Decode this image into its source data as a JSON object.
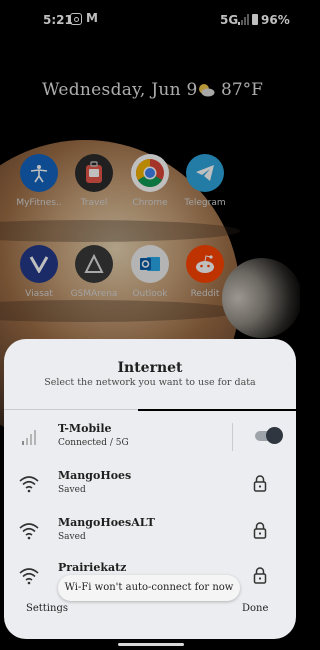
{
  "status_bar": {
    "time": "5:21",
    "network": "5G",
    "battery": "96%",
    "icons": [
      "instagram-icon",
      "gmail-icon",
      "signal-icon",
      "battery-icon"
    ]
  },
  "home": {
    "date_text": "Wednesday, Jun 9",
    "weather_icon": "partly-cloudy-icon",
    "temperature": "87°F",
    "apps": [
      {
        "label": "MyFitnes..",
        "icon": "myfitnesspal-icon",
        "color": "#1565c0"
      },
      {
        "label": "Travel",
        "icon": "travel-icon",
        "color": "#2b2b2b"
      },
      {
        "label": "Chrome",
        "icon": "chrome-icon",
        "color": "#ffffff"
      },
      {
        "label": "Telegram",
        "icon": "telegram-icon",
        "color": "#2ea6de"
      },
      {
        "label": "Viasat",
        "icon": "viasat-icon",
        "color": "#233a8b"
      },
      {
        "label": "GSMArena",
        "icon": "gsmarena-icon",
        "color": "#3a3a3a"
      },
      {
        "label": "Outlook",
        "icon": "outlook-icon",
        "color": "#f1f1f1"
      },
      {
        "label": "Reddit",
        "icon": "reddit-icon",
        "color": "#ff4500"
      }
    ]
  },
  "sheet": {
    "title": "Internet",
    "subtitle": "Select the network you want to use for data",
    "carrier": {
      "name": "T-Mobile",
      "status": "Connected / 5G",
      "toggle_on": true
    },
    "wifi_networks": [
      {
        "name": "MangoHoes",
        "status": "Saved"
      },
      {
        "name": "MangoHoesALT",
        "status": "Saved"
      },
      {
        "name": "Prairiekatz",
        "status": ""
      }
    ],
    "toast": "Wi-Fi won't auto-connect for now",
    "settings_button": "Settings",
    "done_button": "Done"
  },
  "colors": {
    "sheet_bg": "#ecedf0",
    "toggle_thumb": "#2f3640",
    "toggle_track": "#9ea3aa"
  }
}
